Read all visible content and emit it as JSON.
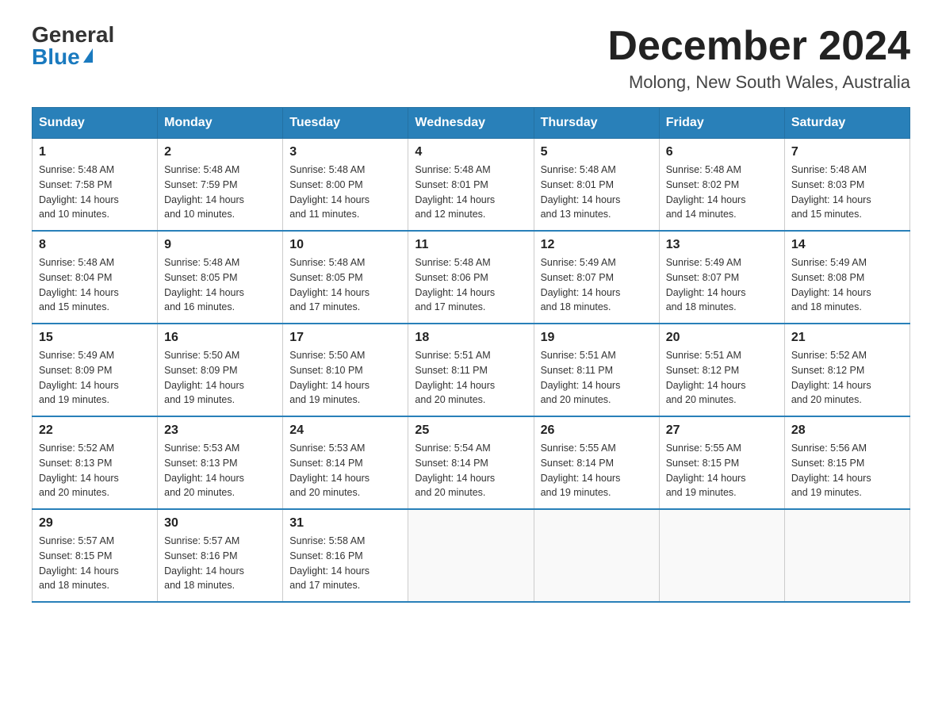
{
  "header": {
    "logo_general": "General",
    "logo_blue": "Blue",
    "month_title": "December 2024",
    "location": "Molong, New South Wales, Australia"
  },
  "weekdays": [
    "Sunday",
    "Monday",
    "Tuesday",
    "Wednesday",
    "Thursday",
    "Friday",
    "Saturday"
  ],
  "weeks": [
    [
      {
        "day": "1",
        "sunrise": "5:48 AM",
        "sunset": "7:58 PM",
        "daylight": "14 hours and 10 minutes."
      },
      {
        "day": "2",
        "sunrise": "5:48 AM",
        "sunset": "7:59 PM",
        "daylight": "14 hours and 10 minutes."
      },
      {
        "day": "3",
        "sunrise": "5:48 AM",
        "sunset": "8:00 PM",
        "daylight": "14 hours and 11 minutes."
      },
      {
        "day": "4",
        "sunrise": "5:48 AM",
        "sunset": "8:01 PM",
        "daylight": "14 hours and 12 minutes."
      },
      {
        "day": "5",
        "sunrise": "5:48 AM",
        "sunset": "8:01 PM",
        "daylight": "14 hours and 13 minutes."
      },
      {
        "day": "6",
        "sunrise": "5:48 AM",
        "sunset": "8:02 PM",
        "daylight": "14 hours and 14 minutes."
      },
      {
        "day": "7",
        "sunrise": "5:48 AM",
        "sunset": "8:03 PM",
        "daylight": "14 hours and 15 minutes."
      }
    ],
    [
      {
        "day": "8",
        "sunrise": "5:48 AM",
        "sunset": "8:04 PM",
        "daylight": "14 hours and 15 minutes."
      },
      {
        "day": "9",
        "sunrise": "5:48 AM",
        "sunset": "8:05 PM",
        "daylight": "14 hours and 16 minutes."
      },
      {
        "day": "10",
        "sunrise": "5:48 AM",
        "sunset": "8:05 PM",
        "daylight": "14 hours and 17 minutes."
      },
      {
        "day": "11",
        "sunrise": "5:48 AM",
        "sunset": "8:06 PM",
        "daylight": "14 hours and 17 minutes."
      },
      {
        "day": "12",
        "sunrise": "5:49 AM",
        "sunset": "8:07 PM",
        "daylight": "14 hours and 18 minutes."
      },
      {
        "day": "13",
        "sunrise": "5:49 AM",
        "sunset": "8:07 PM",
        "daylight": "14 hours and 18 minutes."
      },
      {
        "day": "14",
        "sunrise": "5:49 AM",
        "sunset": "8:08 PM",
        "daylight": "14 hours and 18 minutes."
      }
    ],
    [
      {
        "day": "15",
        "sunrise": "5:49 AM",
        "sunset": "8:09 PM",
        "daylight": "14 hours and 19 minutes."
      },
      {
        "day": "16",
        "sunrise": "5:50 AM",
        "sunset": "8:09 PM",
        "daylight": "14 hours and 19 minutes."
      },
      {
        "day": "17",
        "sunrise": "5:50 AM",
        "sunset": "8:10 PM",
        "daylight": "14 hours and 19 minutes."
      },
      {
        "day": "18",
        "sunrise": "5:51 AM",
        "sunset": "8:11 PM",
        "daylight": "14 hours and 20 minutes."
      },
      {
        "day": "19",
        "sunrise": "5:51 AM",
        "sunset": "8:11 PM",
        "daylight": "14 hours and 20 minutes."
      },
      {
        "day": "20",
        "sunrise": "5:51 AM",
        "sunset": "8:12 PM",
        "daylight": "14 hours and 20 minutes."
      },
      {
        "day": "21",
        "sunrise": "5:52 AM",
        "sunset": "8:12 PM",
        "daylight": "14 hours and 20 minutes."
      }
    ],
    [
      {
        "day": "22",
        "sunrise": "5:52 AM",
        "sunset": "8:13 PM",
        "daylight": "14 hours and 20 minutes."
      },
      {
        "day": "23",
        "sunrise": "5:53 AM",
        "sunset": "8:13 PM",
        "daylight": "14 hours and 20 minutes."
      },
      {
        "day": "24",
        "sunrise": "5:53 AM",
        "sunset": "8:14 PM",
        "daylight": "14 hours and 20 minutes."
      },
      {
        "day": "25",
        "sunrise": "5:54 AM",
        "sunset": "8:14 PM",
        "daylight": "14 hours and 20 minutes."
      },
      {
        "day": "26",
        "sunrise": "5:55 AM",
        "sunset": "8:14 PM",
        "daylight": "14 hours and 19 minutes."
      },
      {
        "day": "27",
        "sunrise": "5:55 AM",
        "sunset": "8:15 PM",
        "daylight": "14 hours and 19 minutes."
      },
      {
        "day": "28",
        "sunrise": "5:56 AM",
        "sunset": "8:15 PM",
        "daylight": "14 hours and 19 minutes."
      }
    ],
    [
      {
        "day": "29",
        "sunrise": "5:57 AM",
        "sunset": "8:15 PM",
        "daylight": "14 hours and 18 minutes."
      },
      {
        "day": "30",
        "sunrise": "5:57 AM",
        "sunset": "8:16 PM",
        "daylight": "14 hours and 18 minutes."
      },
      {
        "day": "31",
        "sunrise": "5:58 AM",
        "sunset": "8:16 PM",
        "daylight": "14 hours and 17 minutes."
      },
      null,
      null,
      null,
      null
    ]
  ],
  "labels": {
    "sunrise": "Sunrise:",
    "sunset": "Sunset:",
    "daylight": "Daylight:"
  }
}
